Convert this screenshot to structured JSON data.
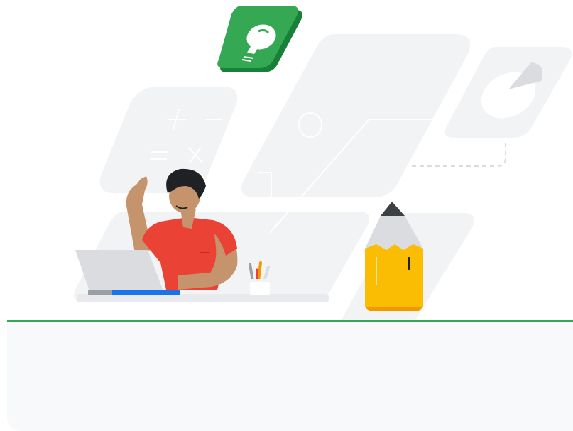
{
  "illustration": {
    "subject": "student-raising-hand",
    "icons": [
      "lightbulb-icon",
      "math-symbols-icon",
      "pie-chart-icon",
      "pencil-icon",
      "laptop-icon",
      "pencil-cup-icon"
    ]
  },
  "colors": {
    "accent_green": "#34a853",
    "card_background": "#f8f9fa",
    "shape_gray": "#f1f3f4",
    "shirt_red": "#ea4335",
    "pencil_yellow": "#fbbc04",
    "laptop_blue": "#1a73e8"
  },
  "content_card": {}
}
